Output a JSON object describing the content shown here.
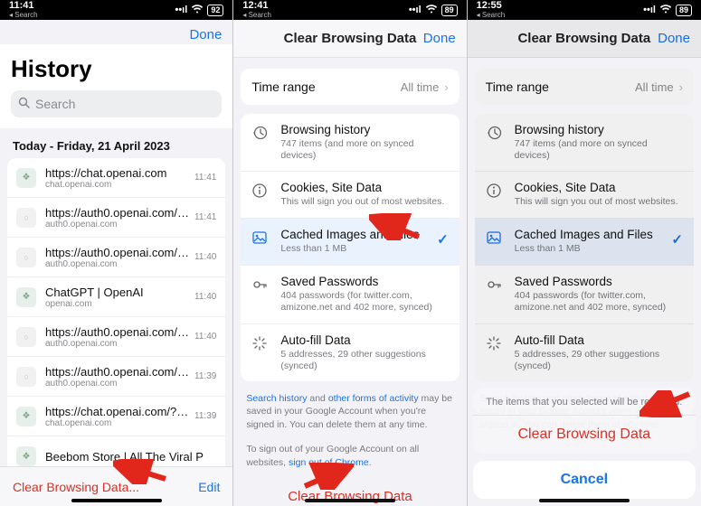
{
  "colors": {
    "accent": "#1a73e8",
    "danger": "#d93025",
    "bg": "#f2f2f7"
  },
  "screen1": {
    "status": {
      "time": "11:41",
      "back": "◂ Search",
      "signal": "▪▪▪▪",
      "wifi": "✓",
      "battery": "92"
    },
    "done": "Done",
    "title": "History",
    "search_placeholder": "Search",
    "date_header": "Today - Friday, 21 April 2023",
    "rows": [
      {
        "title": "https://chat.openai.com",
        "sub": "chat.openai.com",
        "time": "11:41",
        "fav": "green"
      },
      {
        "title": "https://auth0.openai.com/u/lo...",
        "sub": "auth0.openai.com",
        "time": "11:41",
        "fav": "blank"
      },
      {
        "title": "https://auth0.openai.com/u/lo...",
        "sub": "auth0.openai.com",
        "time": "11:40",
        "fav": "blank"
      },
      {
        "title": "ChatGPT | OpenAI",
        "sub": "openai.com",
        "time": "11:40",
        "fav": "green"
      },
      {
        "title": "https://auth0.openai.com/u/lo...",
        "sub": "auth0.openai.com",
        "time": "11:40",
        "fav": "blank"
      },
      {
        "title": "https://auth0.openai.com/auth/l...",
        "sub": "auth0.openai.com",
        "time": "11:39",
        "fav": "blank"
      },
      {
        "title": "https://chat.openai.com/?__cf...",
        "sub": "chat.openai.com",
        "time": "11:39",
        "fav": "green"
      },
      {
        "title": "Beebom Store | All The Viral P",
        "sub": "",
        "time": "",
        "fav": "green"
      }
    ],
    "footer": {
      "clear": "Clear Browsing Data...",
      "edit": "Edit"
    }
  },
  "settings": {
    "status2": {
      "time": "12:41",
      "back": "◂ Search",
      "battery": "89"
    },
    "status3": {
      "time": "12:55",
      "back": "◂ Search",
      "battery": "89"
    },
    "title": "Clear Browsing Data",
    "done": "Done",
    "time_range_label": "Time range",
    "time_range_value": "All time",
    "options": [
      {
        "icon": "history",
        "title": "Browsing history",
        "sub": "747 items (and more on synced devices)",
        "selected": false
      },
      {
        "icon": "info",
        "title": "Cookies, Site Data",
        "sub": "This will sign you out of most websites.",
        "selected": false
      },
      {
        "icon": "image",
        "title": "Cached Images and Files",
        "sub": "Less than 1 MB",
        "selected": true
      },
      {
        "icon": "key",
        "title": "Saved Passwords",
        "sub": "404 passwords (for twitter.com, amizone.net and 402 more, synced)",
        "selected": false
      },
      {
        "icon": "autofill",
        "title": "Auto-fill Data",
        "sub": "5 addresses, 29 other suggestions (synced)",
        "selected": false
      }
    ],
    "note1_a": "Search history",
    "note1_mid": " and ",
    "note1_b": "other forms of activity",
    "note1_rest": " may be saved in your Google Account when you're signed in. You can delete them at any time.",
    "note2_pre": "To sign out of your Google Account on all websites, ",
    "note2_link": "sign out of Chrome",
    "note2_post": ".",
    "clear_button": "Clear Browsing Data",
    "sheet": {
      "message": "The items that you selected will be removed.",
      "action": "Clear Browsing Data",
      "cancel": "Cancel"
    }
  }
}
